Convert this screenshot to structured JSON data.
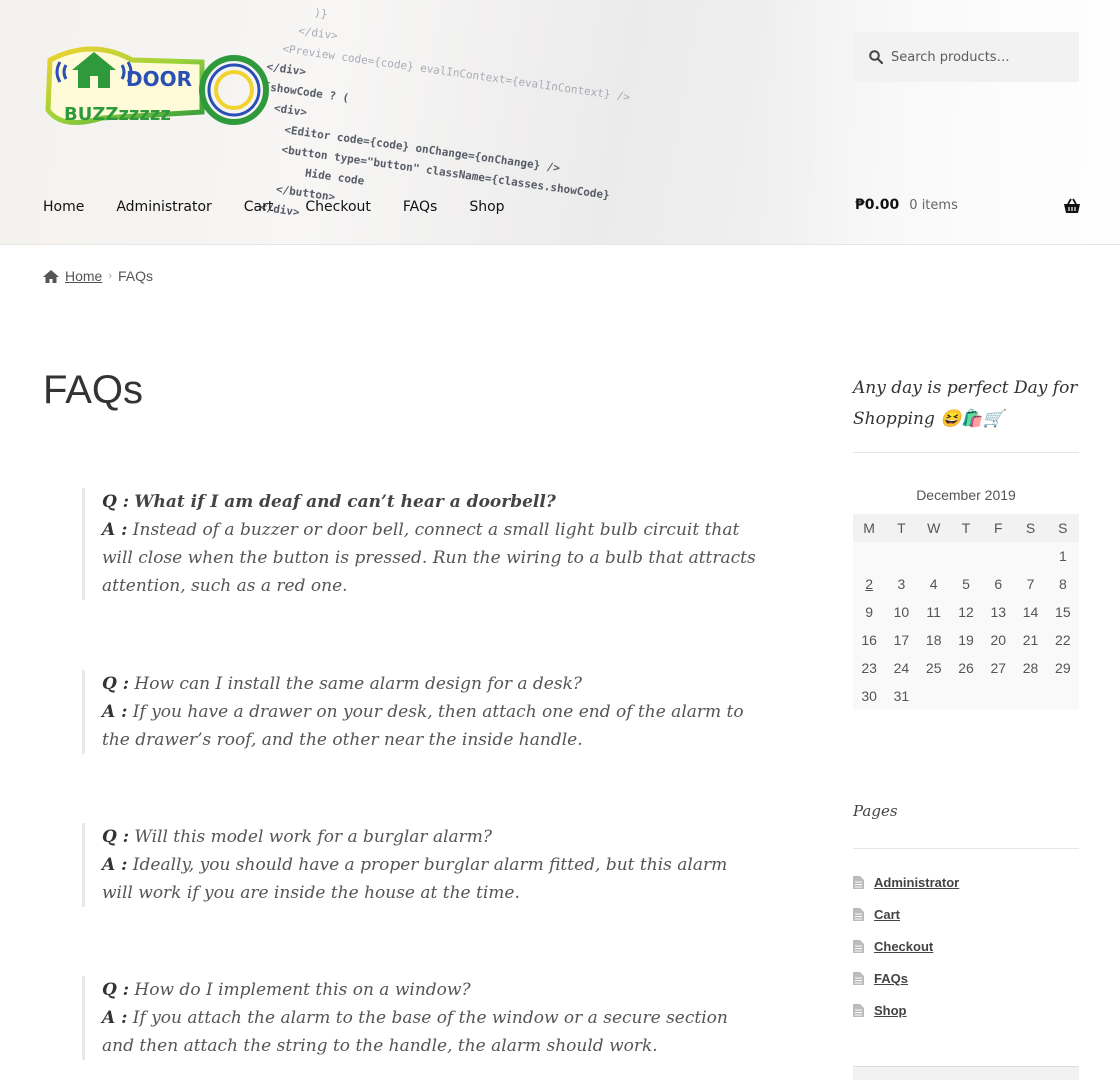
{
  "header": {
    "logo": {
      "line1": "DOOR",
      "line2": "BUZZzzzzz"
    },
    "search": {
      "placeholder": "Search products…"
    },
    "nav": [
      "Home",
      "Administrator",
      "Cart",
      "Checkout",
      "FAQs",
      "Shop"
    ],
    "cart": {
      "amount": "₱0.00",
      "count": "0 items"
    }
  },
  "breadcrumb": {
    "home": "Home",
    "current": "FAQs"
  },
  "main": {
    "title": "FAQs",
    "faqs": [
      {
        "q_label": "Q :",
        "q": "What if I am deaf and can’t hear a doorbell?",
        "a_label": "A :",
        "a": "Instead of a buzzer or door bell, connect a small light bulb circuit that will close when the button is pressed. Run the wiring to a bulb that attracts attention, such as a red one."
      },
      {
        "q_label": "Q :",
        "q": "How can I install the same alarm design for a desk?",
        "a_label": "A :",
        "a": "If you have a drawer on your desk, then attach one end of the alarm to the drawer’s roof, and the other near the inside handle."
      },
      {
        "q_label": "Q :",
        "q": "Will this model work for a burglar alarm?",
        "a_label": "A :",
        "a": "Ideally, you should have a proper burglar alarm fitted, but this alarm will work if you are inside the house at the time."
      },
      {
        "q_label": "Q :",
        "q": "How do I implement this on a window?",
        "a_label": "A :",
        "a": "If you attach the alarm to the base of the window or a secure section and then attach the string to the handle, the alarm should work."
      }
    ]
  },
  "sidebar": {
    "tagline": "Any day is perfect Day for Shopping 😆🛍️🛒",
    "calendar": {
      "caption": "December 2019",
      "weekdays": [
        "M",
        "T",
        "W",
        "T",
        "F",
        "S",
        "S"
      ],
      "weeks": [
        [
          "",
          "",
          "",
          "",
          "",
          "",
          "1"
        ],
        [
          "2",
          "3",
          "4",
          "5",
          "6",
          "7",
          "8"
        ],
        [
          "9",
          "10",
          "11",
          "12",
          "13",
          "14",
          "15"
        ],
        [
          "16",
          "17",
          "18",
          "19",
          "20",
          "21",
          "22"
        ],
        [
          "23",
          "24",
          "25",
          "26",
          "27",
          "28",
          "29"
        ],
        [
          "30",
          "31",
          "",
          "",
          "",
          "",
          ""
        ]
      ],
      "linked_day": "2"
    },
    "pages_title": "Pages",
    "pages": [
      "Administrator",
      "Cart",
      "Checkout",
      "FAQs",
      "Shop"
    ]
  },
  "colors": {
    "accent_green": "#2e9a3c",
    "accent_blue": "#2a4fb5",
    "accent_yellow": "#f2d22e"
  },
  "icons": {
    "search": "search-icon",
    "basket": "basket-icon",
    "home": "home-icon",
    "page": "page-icon"
  }
}
